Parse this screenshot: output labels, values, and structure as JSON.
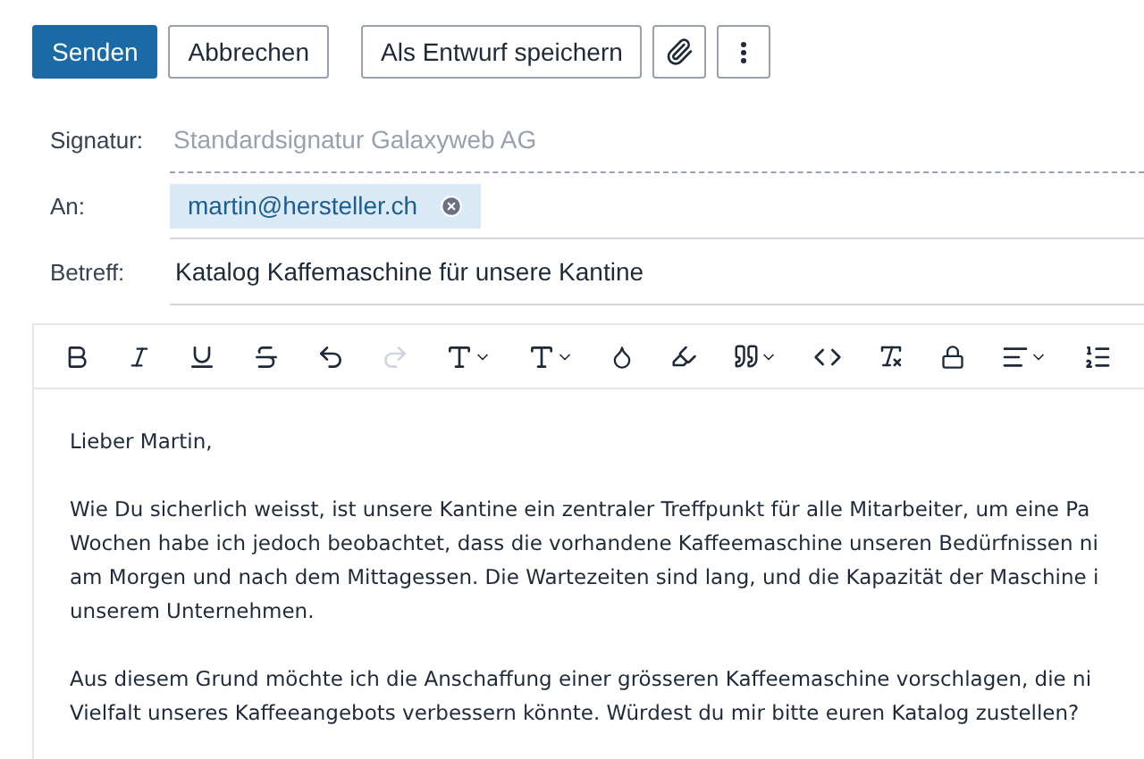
{
  "actions": [
    {
      "label": "Senden",
      "kind": "primary"
    },
    {
      "label": "Abbrechen",
      "kind": "secondary"
    },
    {
      "label": "Als Entwurf speichern",
      "kind": "secondary"
    }
  ],
  "fields": [
    {
      "label": "Signatur:",
      "kind": "placeholder",
      "placeholder": "Standardsignatur Galaxyweb AG"
    },
    {
      "label": "An:",
      "kind": "recipients",
      "value": "martin@hersteller.ch"
    },
    {
      "label": "Betreff:",
      "kind": "text",
      "value": "Katalog Kaffemaschine für unsere Kantine"
    }
  ],
  "editor": {
    "paragraphs": [
      [
        "Lieber Martin,"
      ],
      [
        "Wie Du sicherlich weisst, ist unsere Kantine ein zentraler Treffpunkt für alle Mitarbeiter, um eine Pa",
        "Wochen habe ich jedoch beobachtet, dass die vorhandene Kaffeemaschine unseren Bedürfnissen ni",
        "am Morgen und nach dem Mittagessen. Die Wartezeiten sind lang, und die Kapazität der Maschine i",
        "unserem Unternehmen."
      ],
      [
        "Aus diesem Grund möchte ich die Anschaffung einer grösseren Kaffeemaschine vorschlagen, die ni",
        "Vielfalt unseres Kaffeeangebots verbessern könnte. Würdest du mir bitte euren Katalog zustellen?"
      ]
    ]
  }
}
